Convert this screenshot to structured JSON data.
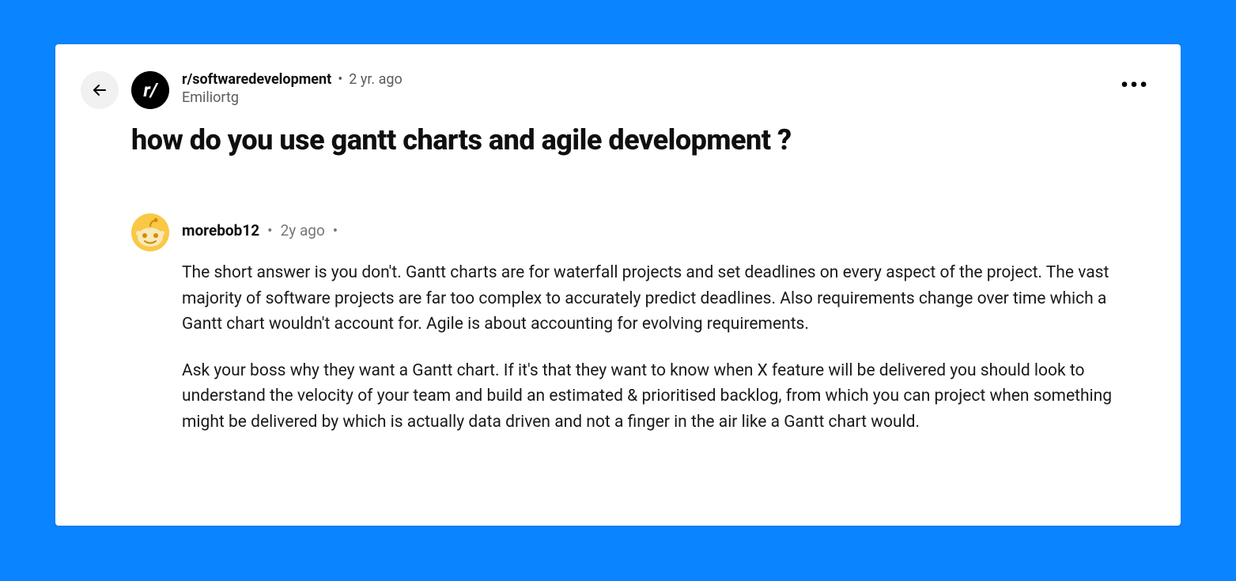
{
  "post": {
    "subreddit": "r/softwaredevelopment",
    "age": "2 yr. ago",
    "author": "Emiliortg",
    "title": "how do you use gantt charts and agile development ?",
    "subAvatarText": "r/"
  },
  "comment": {
    "author": "morebob12",
    "age": "2y ago",
    "para1": "The short answer is you don't. Gantt charts are for waterfall projects and set deadlines on every aspect of the project. The vast majority of software projects are far too complex to accurately predict deadlines. Also requirements change over time which a Gantt chart wouldn't account for. Agile is about accounting for evolving requirements.",
    "para2": "Ask your boss why they want a Gantt chart. If it's that they want to know when X feature will be delivered you should look to understand the velocity of your team and build an estimated & prioritised backlog, from which you can project when something might be delivered by which is actually data driven and not a finger in the air like a Gantt chart would."
  }
}
